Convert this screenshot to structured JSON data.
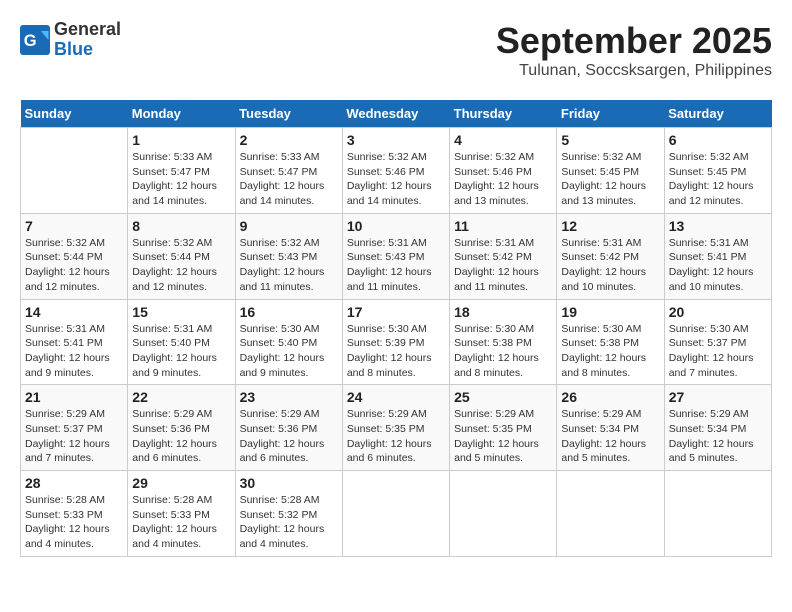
{
  "header": {
    "logo_general": "General",
    "logo_blue": "Blue",
    "month_title": "September 2025",
    "location": "Tulunan, Soccsksargen, Philippines"
  },
  "days_of_week": [
    "Sunday",
    "Monday",
    "Tuesday",
    "Wednesday",
    "Thursday",
    "Friday",
    "Saturday"
  ],
  "weeks": [
    [
      {
        "day": "",
        "sunrise": "",
        "sunset": "",
        "daylight": ""
      },
      {
        "day": "1",
        "sunrise": "Sunrise: 5:33 AM",
        "sunset": "Sunset: 5:47 PM",
        "daylight": "Daylight: 12 hours and 14 minutes."
      },
      {
        "day": "2",
        "sunrise": "Sunrise: 5:33 AM",
        "sunset": "Sunset: 5:47 PM",
        "daylight": "Daylight: 12 hours and 14 minutes."
      },
      {
        "day": "3",
        "sunrise": "Sunrise: 5:32 AM",
        "sunset": "Sunset: 5:46 PM",
        "daylight": "Daylight: 12 hours and 14 minutes."
      },
      {
        "day": "4",
        "sunrise": "Sunrise: 5:32 AM",
        "sunset": "Sunset: 5:46 PM",
        "daylight": "Daylight: 12 hours and 13 minutes."
      },
      {
        "day": "5",
        "sunrise": "Sunrise: 5:32 AM",
        "sunset": "Sunset: 5:45 PM",
        "daylight": "Daylight: 12 hours and 13 minutes."
      },
      {
        "day": "6",
        "sunrise": "Sunrise: 5:32 AM",
        "sunset": "Sunset: 5:45 PM",
        "daylight": "Daylight: 12 hours and 12 minutes."
      }
    ],
    [
      {
        "day": "7",
        "sunrise": "Sunrise: 5:32 AM",
        "sunset": "Sunset: 5:44 PM",
        "daylight": "Daylight: 12 hours and 12 minutes."
      },
      {
        "day": "8",
        "sunrise": "Sunrise: 5:32 AM",
        "sunset": "Sunset: 5:44 PM",
        "daylight": "Daylight: 12 hours and 12 minutes."
      },
      {
        "day": "9",
        "sunrise": "Sunrise: 5:32 AM",
        "sunset": "Sunset: 5:43 PM",
        "daylight": "Daylight: 12 hours and 11 minutes."
      },
      {
        "day": "10",
        "sunrise": "Sunrise: 5:31 AM",
        "sunset": "Sunset: 5:43 PM",
        "daylight": "Daylight: 12 hours and 11 minutes."
      },
      {
        "day": "11",
        "sunrise": "Sunrise: 5:31 AM",
        "sunset": "Sunset: 5:42 PM",
        "daylight": "Daylight: 12 hours and 11 minutes."
      },
      {
        "day": "12",
        "sunrise": "Sunrise: 5:31 AM",
        "sunset": "Sunset: 5:42 PM",
        "daylight": "Daylight: 12 hours and 10 minutes."
      },
      {
        "day": "13",
        "sunrise": "Sunrise: 5:31 AM",
        "sunset": "Sunset: 5:41 PM",
        "daylight": "Daylight: 12 hours and 10 minutes."
      }
    ],
    [
      {
        "day": "14",
        "sunrise": "Sunrise: 5:31 AM",
        "sunset": "Sunset: 5:41 PM",
        "daylight": "Daylight: 12 hours and 9 minutes."
      },
      {
        "day": "15",
        "sunrise": "Sunrise: 5:31 AM",
        "sunset": "Sunset: 5:40 PM",
        "daylight": "Daylight: 12 hours and 9 minutes."
      },
      {
        "day": "16",
        "sunrise": "Sunrise: 5:30 AM",
        "sunset": "Sunset: 5:40 PM",
        "daylight": "Daylight: 12 hours and 9 minutes."
      },
      {
        "day": "17",
        "sunrise": "Sunrise: 5:30 AM",
        "sunset": "Sunset: 5:39 PM",
        "daylight": "Daylight: 12 hours and 8 minutes."
      },
      {
        "day": "18",
        "sunrise": "Sunrise: 5:30 AM",
        "sunset": "Sunset: 5:38 PM",
        "daylight": "Daylight: 12 hours and 8 minutes."
      },
      {
        "day": "19",
        "sunrise": "Sunrise: 5:30 AM",
        "sunset": "Sunset: 5:38 PM",
        "daylight": "Daylight: 12 hours and 8 minutes."
      },
      {
        "day": "20",
        "sunrise": "Sunrise: 5:30 AM",
        "sunset": "Sunset: 5:37 PM",
        "daylight": "Daylight: 12 hours and 7 minutes."
      }
    ],
    [
      {
        "day": "21",
        "sunrise": "Sunrise: 5:29 AM",
        "sunset": "Sunset: 5:37 PM",
        "daylight": "Daylight: 12 hours and 7 minutes."
      },
      {
        "day": "22",
        "sunrise": "Sunrise: 5:29 AM",
        "sunset": "Sunset: 5:36 PM",
        "daylight": "Daylight: 12 hours and 6 minutes."
      },
      {
        "day": "23",
        "sunrise": "Sunrise: 5:29 AM",
        "sunset": "Sunset: 5:36 PM",
        "daylight": "Daylight: 12 hours and 6 minutes."
      },
      {
        "day": "24",
        "sunrise": "Sunrise: 5:29 AM",
        "sunset": "Sunset: 5:35 PM",
        "daylight": "Daylight: 12 hours and 6 minutes."
      },
      {
        "day": "25",
        "sunrise": "Sunrise: 5:29 AM",
        "sunset": "Sunset: 5:35 PM",
        "daylight": "Daylight: 12 hours and 5 minutes."
      },
      {
        "day": "26",
        "sunrise": "Sunrise: 5:29 AM",
        "sunset": "Sunset: 5:34 PM",
        "daylight": "Daylight: 12 hours and 5 minutes."
      },
      {
        "day": "27",
        "sunrise": "Sunrise: 5:29 AM",
        "sunset": "Sunset: 5:34 PM",
        "daylight": "Daylight: 12 hours and 5 minutes."
      }
    ],
    [
      {
        "day": "28",
        "sunrise": "Sunrise: 5:28 AM",
        "sunset": "Sunset: 5:33 PM",
        "daylight": "Daylight: 12 hours and 4 minutes."
      },
      {
        "day": "29",
        "sunrise": "Sunrise: 5:28 AM",
        "sunset": "Sunset: 5:33 PM",
        "daylight": "Daylight: 12 hours and 4 minutes."
      },
      {
        "day": "30",
        "sunrise": "Sunrise: 5:28 AM",
        "sunset": "Sunset: 5:32 PM",
        "daylight": "Daylight: 12 hours and 4 minutes."
      },
      {
        "day": "",
        "sunrise": "",
        "sunset": "",
        "daylight": ""
      },
      {
        "day": "",
        "sunrise": "",
        "sunset": "",
        "daylight": ""
      },
      {
        "day": "",
        "sunrise": "",
        "sunset": "",
        "daylight": ""
      },
      {
        "day": "",
        "sunrise": "",
        "sunset": "",
        "daylight": ""
      }
    ]
  ]
}
